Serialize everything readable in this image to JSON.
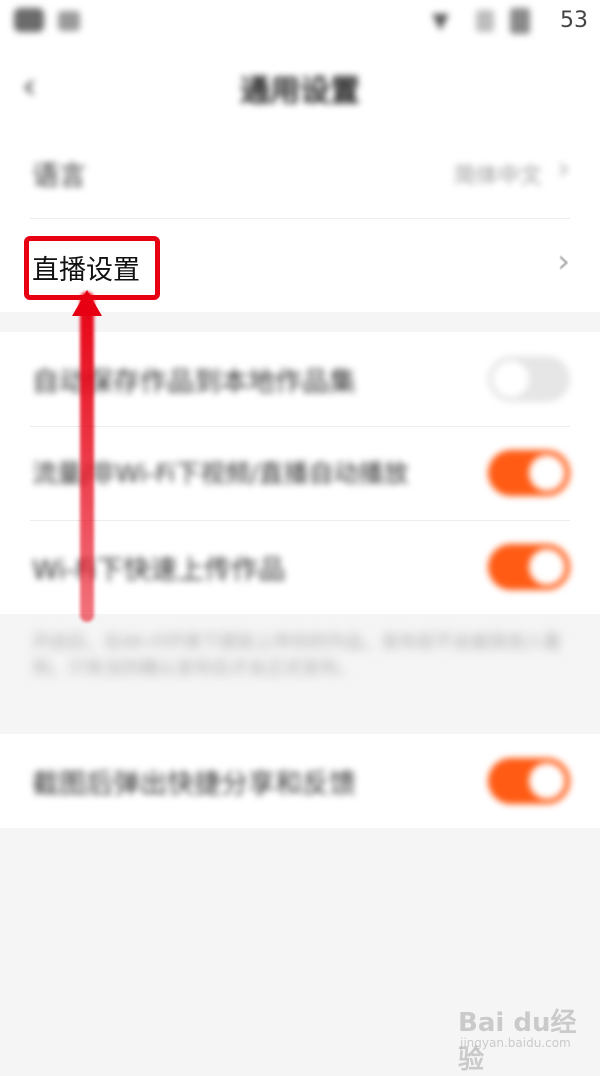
{
  "status_bar": {
    "time": "53"
  },
  "header": {
    "back_icon": "chevron-left-icon",
    "title": "通用设置"
  },
  "settings": {
    "language": {
      "label": "语言",
      "value": "简体中文"
    },
    "live": {
      "label": "直播设置"
    },
    "toggles": [
      {
        "label": "自动保存作品到本地作品集",
        "on": false
      },
      {
        "label": "流量/非Wi-Fi下视频/直播自动播放",
        "on": true
      },
      {
        "label": "Wi-Fi下快速上传作品",
        "on": true
      }
    ],
    "note": "开启后，在Wi-Fi环境下提前上传你的作品，发布前不会被其他人看到。只有当你确认发布后才会正式发布。",
    "screenshot_share": {
      "label": "截图后弹出快捷分享和反馈",
      "on": true
    }
  },
  "colors": {
    "accent": "#ff5b14",
    "highlight": "#e60012"
  },
  "watermark": {
    "text": "Bai du经验",
    "sub": "jingyan.baidu.com"
  }
}
